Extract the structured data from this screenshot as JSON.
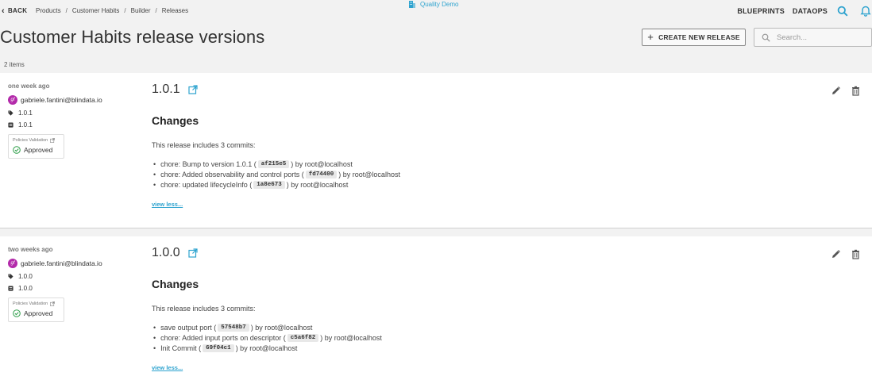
{
  "nav": {
    "back_label": "BACK",
    "breadcrumbs": [
      "Products",
      "Customer Habits",
      "Builder",
      "Releases"
    ],
    "tenant": "Quality Demo",
    "links": [
      "BLUEPRINTS",
      "DATAOPS"
    ],
    "icons": [
      "search-icon",
      "bell-icon"
    ]
  },
  "page": {
    "title": "Customer Habits release versions",
    "create_label": "CREATE NEW RELEASE",
    "search_placeholder": "Search...",
    "count": "2 items"
  },
  "colors": {
    "accent": "#2ea3cf",
    "avatar": "#b32aaa",
    "approved": "#2e9e49"
  },
  "releases": [
    {
      "ago": "one week ago",
      "user": "gabriele.fantini@blindata.io",
      "avatar": "gf",
      "tag": "1.0.1",
      "version_meta": "1.0.1",
      "policy_title": "Policies Validation",
      "policy_status": "Approved",
      "version": "1.0.1",
      "changes_title": "Changes",
      "intro": "This release includes 3 commits:",
      "commits": [
        {
          "pre": "chore: Bump to version 1.0.1 (",
          "hash": "af215e5",
          "post": ") by root@localhost"
        },
        {
          "pre": "chore: Added observability and control ports (",
          "hash": "fd74400",
          "post": ") by root@localhost"
        },
        {
          "pre": "chore: updated lifecycleInfo (",
          "hash": "1a8e673",
          "post": ") by root@localhost"
        }
      ],
      "view_less": "view less..."
    },
    {
      "ago": "two weeks ago",
      "user": "gabriele.fantini@blindata.io",
      "avatar": "gf",
      "tag": "1.0.0",
      "version_meta": "1.0.0",
      "policy_title": "Policies Validation",
      "policy_status": "Approved",
      "version": "1.0.0",
      "changes_title": "Changes",
      "intro": "This release includes 3 commits:",
      "commits": [
        {
          "pre": "save output port (",
          "hash": "57548b7",
          "post": ") by root@localhost"
        },
        {
          "pre": "chore: Added input ports on descriptor (",
          "hash": "c5a6f82",
          "post": ") by root@localhost"
        },
        {
          "pre": "Init Commit (",
          "hash": "69f04c1",
          "post": ") by root@localhost"
        }
      ],
      "view_less": "view less..."
    }
  ]
}
